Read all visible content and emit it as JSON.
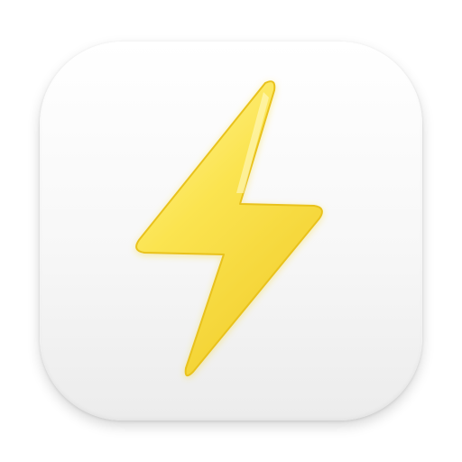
{
  "app_icon": {
    "icon": "lightning-bolt-icon",
    "colors": {
      "tile_top": "#ffffff",
      "tile_bottom": "#ececec",
      "bolt_fill_light": "#fff49a",
      "bolt_fill_mid": "#fbe451",
      "bolt_fill_dark": "#f2cf2e",
      "bolt_edge": "#e9c21f"
    }
  }
}
